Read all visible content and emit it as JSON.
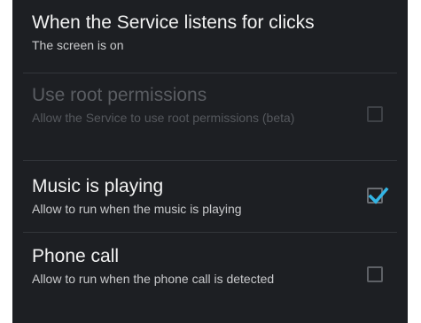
{
  "settings": {
    "items": [
      {
        "title": "When the Service listens for clicks",
        "summary": "The screen is on",
        "enabled": true
      },
      {
        "title": "Use root permissions",
        "summary": "Allow the Service to use root permissions (beta)",
        "enabled": false,
        "checked": false
      },
      {
        "title": "Music is playing",
        "summary": "Allow to run when the music is playing",
        "enabled": true,
        "checked": true
      },
      {
        "title": "Phone call",
        "summary": "Allow to run when the phone call is detected",
        "enabled": true,
        "checked": false
      }
    ]
  },
  "colors": {
    "background": "#1d1f23",
    "accent": "#33b5e5",
    "text_primary": "#f2f2f2",
    "text_disabled": "#5a5d62"
  }
}
